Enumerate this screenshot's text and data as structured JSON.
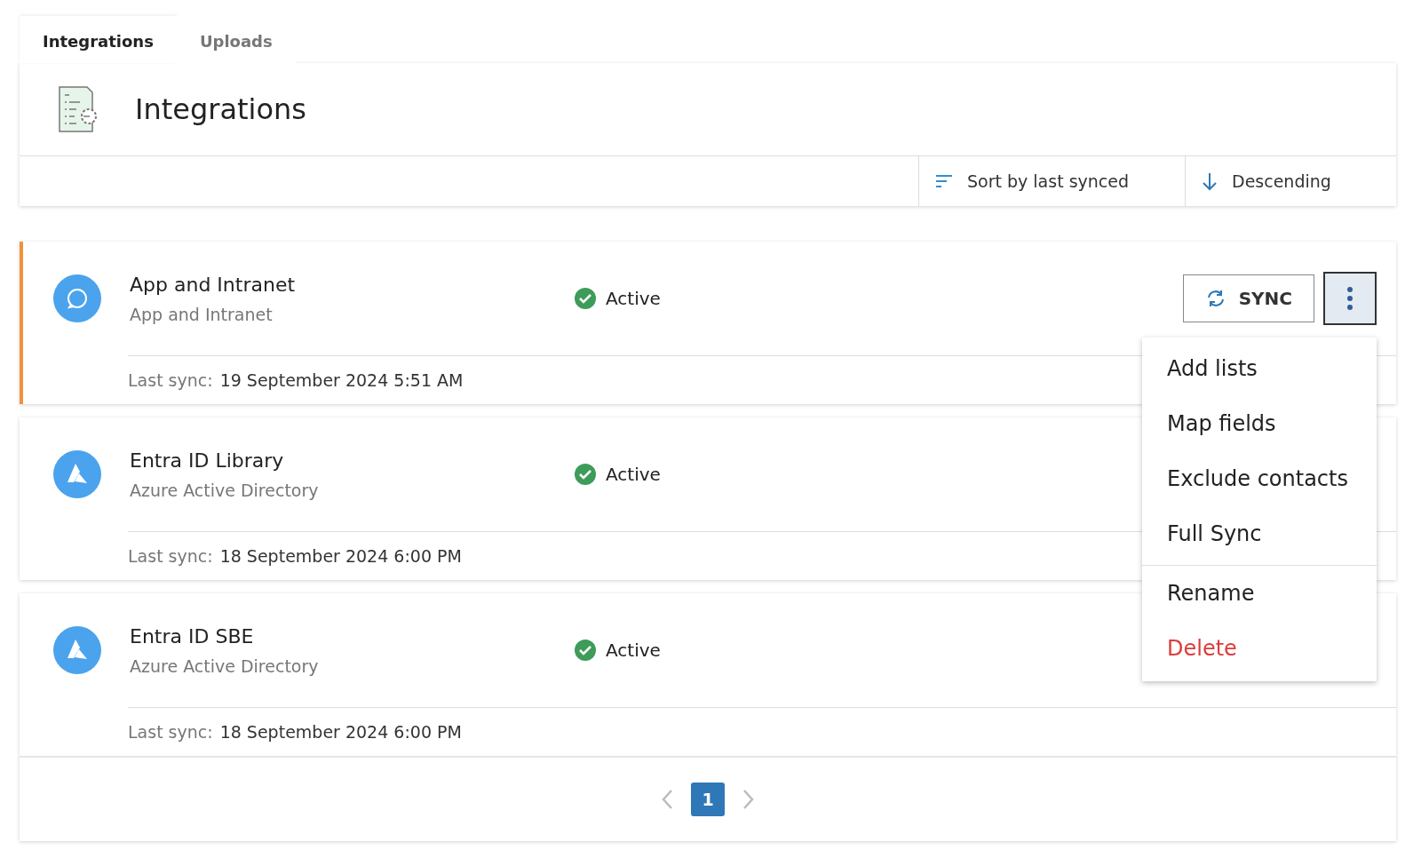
{
  "tabs": [
    {
      "label": "Integrations",
      "selected": true
    },
    {
      "label": "Uploads",
      "selected": false
    }
  ],
  "header": {
    "title": "Integrations"
  },
  "toolbar": {
    "sort": "Sort by last synced",
    "order": "Descending"
  },
  "integrations": [
    {
      "name": "App and Intranet",
      "source": "App and Intranet",
      "kind": "app",
      "status": "Active",
      "last_sync_label": "Last sync:",
      "last_sync": "19 September 2024 5:51 AM",
      "selected": true,
      "sync_button": "SYNC",
      "menu_open": true
    },
    {
      "name": "Entra ID Library",
      "source": "Azure Active Directory",
      "kind": "azure",
      "status": "Active",
      "last_sync_label": "Last sync:",
      "last_sync": "18 September 2024 6:00 PM",
      "selected": false,
      "menu_open": false
    },
    {
      "name": "Entra ID SBE",
      "source": "Azure Active Directory",
      "kind": "azure",
      "status": "Active",
      "last_sync_label": "Last sync:",
      "last_sync": "18 September 2024 6:00 PM",
      "selected": false,
      "menu_open": false
    }
  ],
  "menu": [
    {
      "label": "Add lists",
      "kind": "normal"
    },
    {
      "label": "Map fields",
      "kind": "normal"
    },
    {
      "label": "Exclude contacts",
      "kind": "normal"
    },
    {
      "label": "Full Sync",
      "kind": "normal"
    },
    {
      "label": "Rename",
      "kind": "separated"
    },
    {
      "label": "Delete",
      "kind": "danger"
    }
  ],
  "pagination": {
    "pages": [
      {
        "label": "1",
        "selected": true
      }
    ]
  }
}
